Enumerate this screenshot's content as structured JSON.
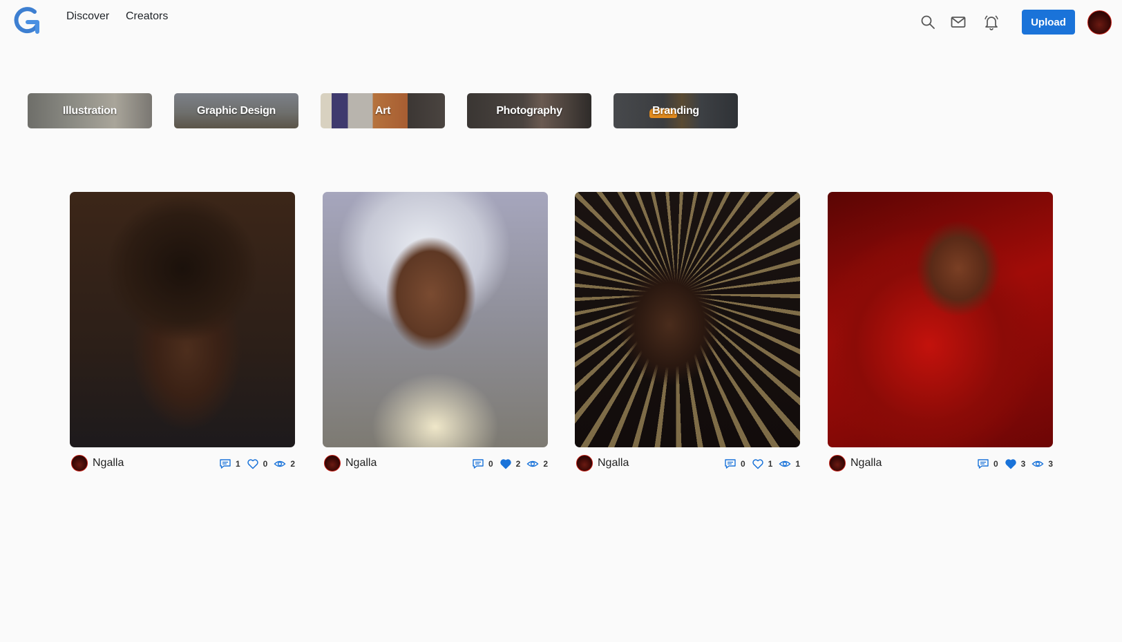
{
  "header": {
    "nav": [
      "Discover",
      "Creators"
    ],
    "upload_label": "Upload"
  },
  "colors": {
    "accent": "#1a73d9",
    "icon_gray": "#555555",
    "icon_blue": "#1a73d9"
  },
  "categories": [
    {
      "label": "Illustration"
    },
    {
      "label": "Graphic Design"
    },
    {
      "label": "Art"
    },
    {
      "label": "Photography"
    },
    {
      "label": "Branding"
    }
  ],
  "cards": [
    {
      "author": "Ngalla",
      "comments": "1",
      "likes": "0",
      "liked": false,
      "views": "2"
    },
    {
      "author": "Ngalla",
      "comments": "0",
      "likes": "2",
      "liked": true,
      "views": "2"
    },
    {
      "author": "Ngalla",
      "comments": "0",
      "likes": "1",
      "liked": false,
      "views": "1"
    },
    {
      "author": "Ngalla",
      "comments": "0",
      "likes": "3",
      "liked": true,
      "views": "3"
    }
  ]
}
